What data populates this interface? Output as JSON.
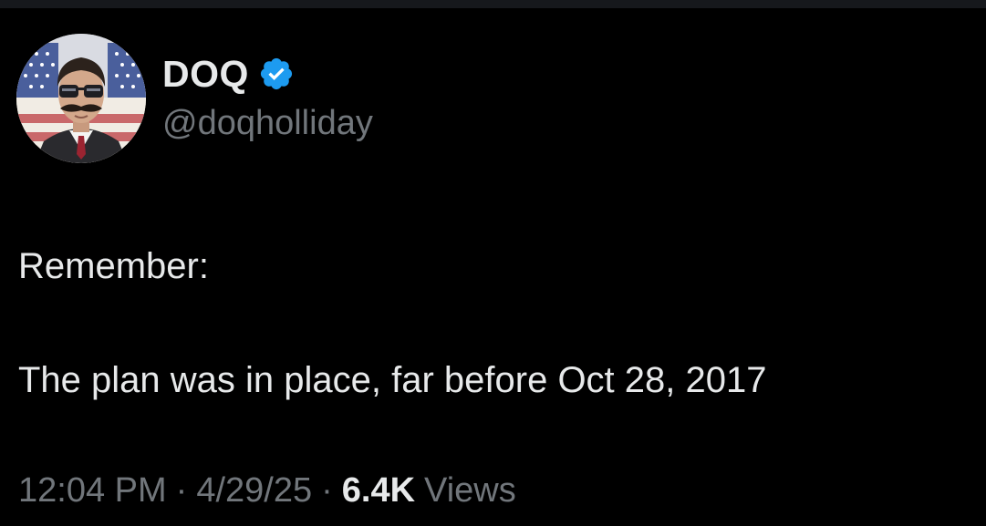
{
  "author": {
    "display_name": "DOQ",
    "handle": "@doqholliday",
    "verified": true,
    "verified_color": "#1d9bf0",
    "avatar_icon": "avatar-portrait"
  },
  "tweet": {
    "lines": [
      "Remember:",
      "The plan was in place, far before Oct 28, 2017"
    ]
  },
  "meta": {
    "time": "12:04 PM",
    "separator": "·",
    "date": "4/29/25",
    "views_count": "6.4K",
    "views_label": "Views"
  },
  "colors": {
    "background": "#000000",
    "text_primary": "#e7e9ea",
    "text_secondary": "#71767b"
  }
}
